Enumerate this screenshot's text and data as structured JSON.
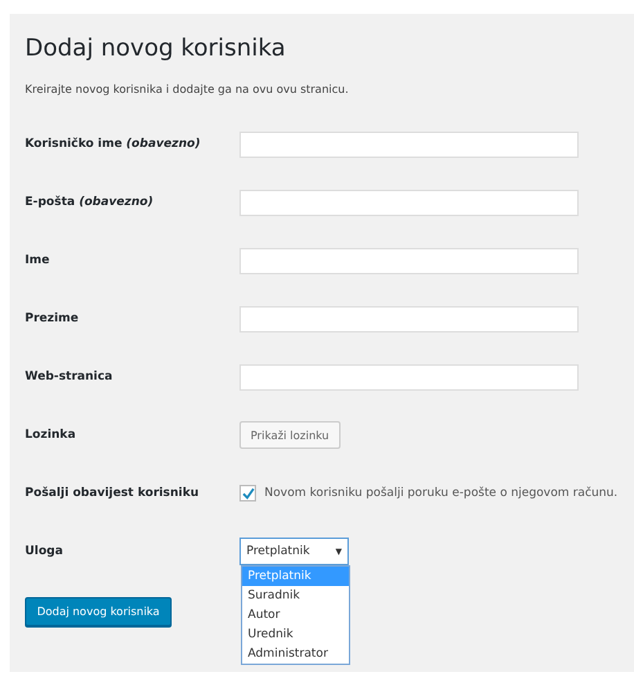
{
  "title": "Dodaj novog korisnika",
  "description": "Kreirajte novog korisnika i dodajte ga na ovu ovu stranicu.",
  "fields": [
    {
      "kind": "text",
      "label": "Korisničko ime *(obavezno)*"
    },
    {
      "kind": "text",
      "label": "E-pošta *(obavezno)*"
    },
    {
      "kind": "text",
      "label": "Ime"
    },
    {
      "kind": "text",
      "label": "Prezime"
    },
    {
      "kind": "text",
      "label": "Web-stranica"
    },
    {
      "kind": "button",
      "label": "Lozinka",
      "button": "Prikaži lozinku"
    },
    {
      "kind": "checkbox",
      "label": "Pošalji obavijest korisniku",
      "checked": true,
      "text": "Novom korisniku pošalji poruku e-pošte o njegovom računu."
    },
    {
      "kind": "select",
      "label": "Uloga",
      "value": "Pretplatnik",
      "arrow": "▼",
      "expanded": true,
      "options": [
        {
          "label": "Pretplatnik",
          "selected": true
        },
        {
          "label": "Suradnik",
          "selected": false
        },
        {
          "label": "Autor",
          "selected": false
        },
        {
          "label": "Urednik",
          "selected": false
        },
        {
          "label": "Administrator",
          "selected": false
        }
      ]
    }
  ],
  "submit": "Dodaj novog korisnika"
}
